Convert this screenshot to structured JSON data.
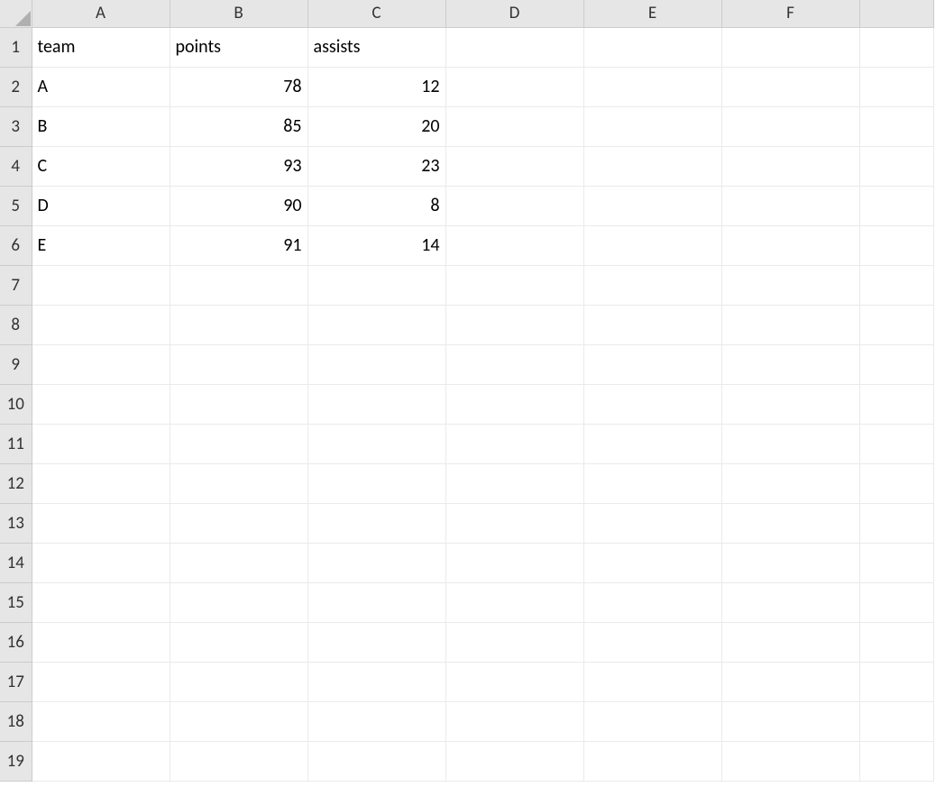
{
  "columns": [
    "A",
    "B",
    "C",
    "D",
    "E",
    "F",
    ""
  ],
  "rows": [
    "1",
    "2",
    "3",
    "4",
    "5",
    "6",
    "7",
    "8",
    "9",
    "10",
    "11",
    "12",
    "13",
    "14",
    "15",
    "16",
    "17",
    "18",
    "19"
  ],
  "cells": {
    "A1": "team",
    "B1": "points",
    "C1": "assists",
    "A2": "A",
    "B2": "78",
    "C2": "12",
    "A3": "B",
    "B3": "85",
    "C3": "20",
    "A4": "C",
    "B4": "93",
    "C4": "23",
    "A5": "D",
    "B5": "90",
    "C5": "8",
    "A6": "E",
    "B6": "91",
    "C6": "14"
  },
  "chart_data": {
    "type": "table",
    "columns": [
      "team",
      "points",
      "assists"
    ],
    "rows": [
      {
        "team": "A",
        "points": 78,
        "assists": 12
      },
      {
        "team": "B",
        "points": 85,
        "assists": 20
      },
      {
        "team": "C",
        "points": 93,
        "assists": 23
      },
      {
        "team": "D",
        "points": 90,
        "assists": 8
      },
      {
        "team": "E",
        "points": 91,
        "assists": 14
      }
    ]
  }
}
